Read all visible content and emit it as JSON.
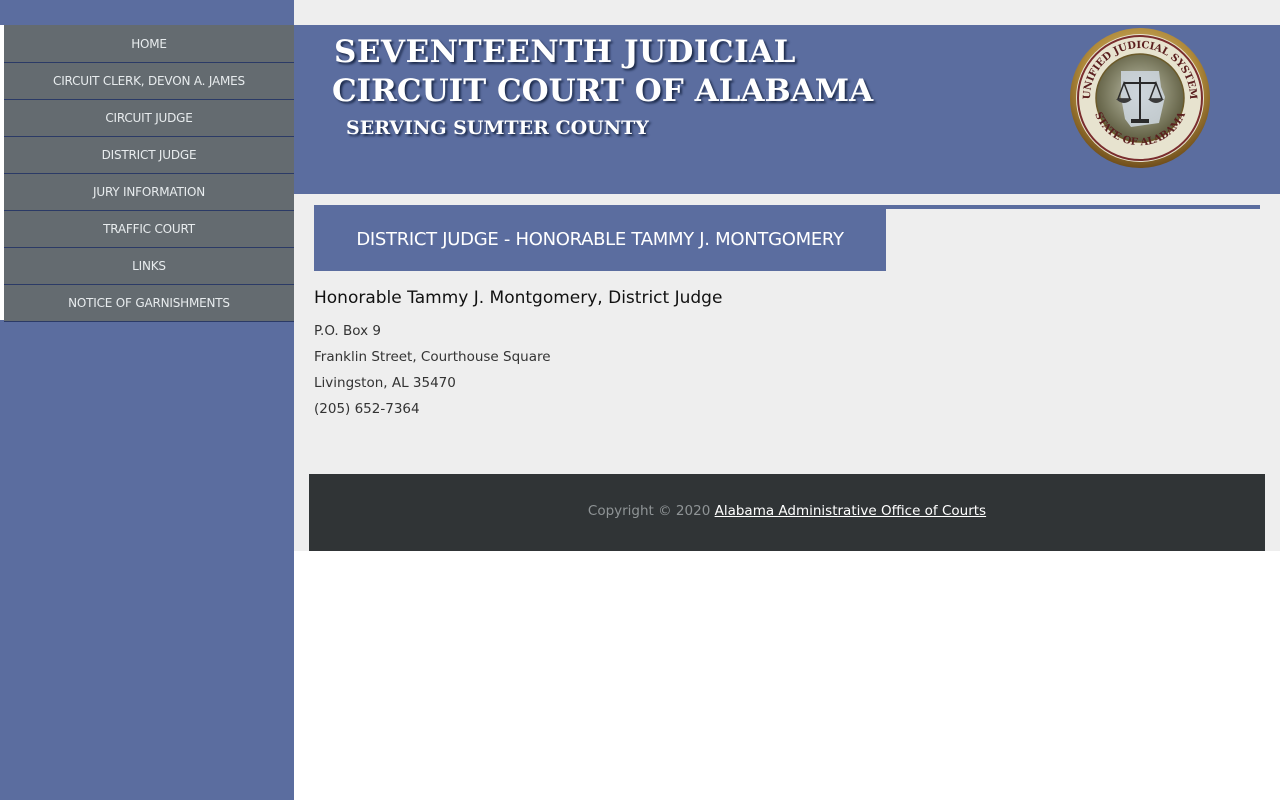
{
  "nav": {
    "items": [
      {
        "label": "HOME"
      },
      {
        "label": "CIRCUIT CLERK, DEVON A. JAMES"
      },
      {
        "label": "CIRCUIT JUDGE"
      },
      {
        "label": "DISTRICT JUDGE"
      },
      {
        "label": "JURY INFORMATION"
      },
      {
        "label": "TRAFFIC COURT"
      },
      {
        "label": "LINKS"
      },
      {
        "label": "NOTICE OF GARNISHMENTS"
      }
    ]
  },
  "banner": {
    "title_line1": "SEVENTEENTH  JUDICIAL",
    "title_line2": "CIRCUIT COURT OF ALABAMA",
    "title_line3": "SERVING SUMTER COUNTY",
    "seal_text": "UNIFIED JUDICIAL SYSTEM · STATE OF ALABAMA"
  },
  "page": {
    "heading": "DISTRICT JUDGE - HONORABLE TAMMY J. MONTGOMERY"
  },
  "contact": {
    "name": "Honorable Tammy J. Montgomery, District Judge",
    "po_box": "P.O. Box 9",
    "street": "Franklin Street, Courthouse Square",
    "city": "Livingston, AL 35470",
    "phone": "(205) 652-7364"
  },
  "footer": {
    "copyright": "Copyright © 2020",
    "link_text": "Alabama Administrative Office of Courts"
  },
  "colors": {
    "brand_blue": "#5b6d9f",
    "nav_gray": "#646b70",
    "footer_dark": "#303436",
    "content_bg": "#eeeeee"
  },
  "icons": {
    "seal": "alabama-judicial-seal-icon"
  }
}
